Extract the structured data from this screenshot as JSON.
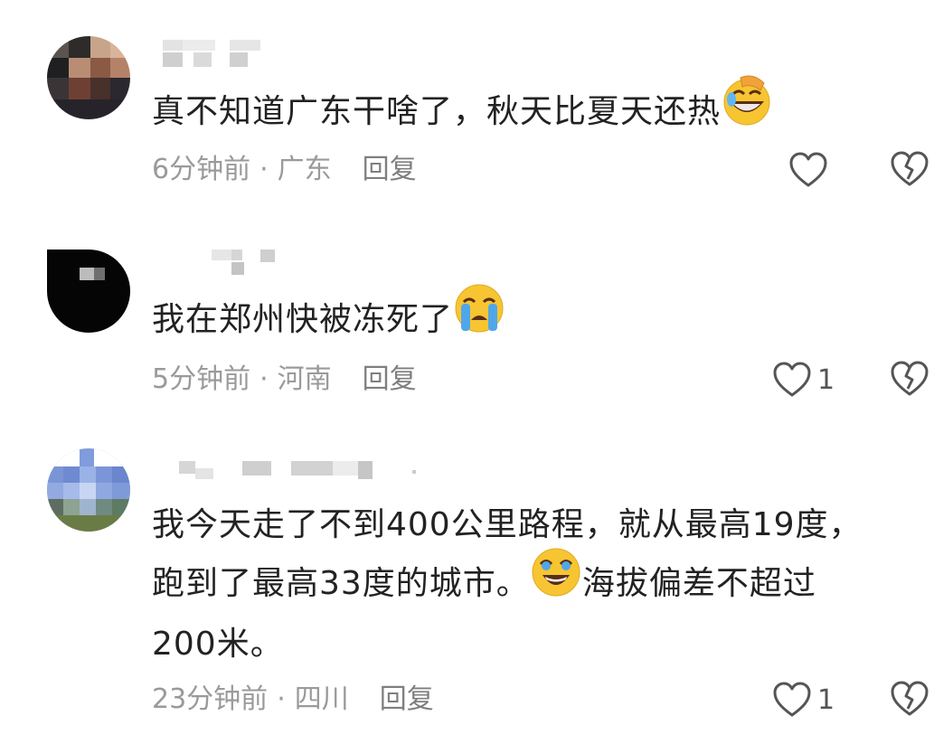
{
  "comments": [
    {
      "text": "真不知道广东干啥了，秋天比夏天还热",
      "emoji_icon": "face-with-hand-over-mouth-laughing",
      "time": "6分钟前",
      "separator": "·",
      "location": "广东",
      "reply_label": "回复",
      "like_count": ""
    },
    {
      "text": "我在郑州快被冻死了",
      "emoji_icon": "loudly-crying-face",
      "time": "5分钟前",
      "separator": "·",
      "location": "河南",
      "reply_label": "回复",
      "like_count": "1"
    },
    {
      "text_line1": "我今天走了不到400公里路程，就从最高19度，",
      "text_line2a": "跑到了最高33度的城市。",
      "text_line2b": "海拔偏差不超过",
      "text_line3": "200米。",
      "emoji_icon": "tears-of-joy-face",
      "time": "23分钟前",
      "separator": "·",
      "location": "四川",
      "reply_label": "回复",
      "like_count": "1"
    }
  ],
  "icons": {
    "like": "heart-outline-icon",
    "dislike": "broken-heart-icon"
  },
  "colors": {
    "text": "#222222",
    "meta": "#9a9a9a",
    "icon": "#555555",
    "emoji": "#f7c531"
  }
}
